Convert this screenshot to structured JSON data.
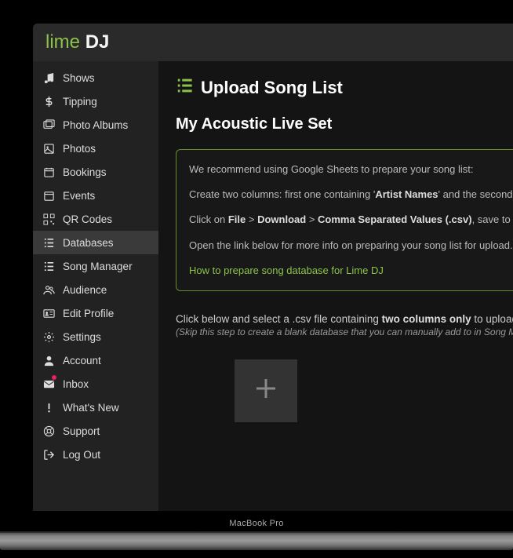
{
  "brand": {
    "part1": "lime",
    "part2": "DJ"
  },
  "sidebar": {
    "items": [
      {
        "label": "Shows"
      },
      {
        "label": "Tipping"
      },
      {
        "label": "Photo Albums"
      },
      {
        "label": "Photos"
      },
      {
        "label": "Bookings"
      },
      {
        "label": "Events"
      },
      {
        "label": "QR Codes"
      },
      {
        "label": "Databases"
      },
      {
        "label": "Song Manager"
      },
      {
        "label": "Audience"
      },
      {
        "label": "Edit Profile"
      },
      {
        "label": "Settings"
      },
      {
        "label": "Account"
      },
      {
        "label": "Inbox"
      },
      {
        "label": "What's New"
      },
      {
        "label": "Support"
      },
      {
        "label": "Log Out"
      }
    ],
    "active_index": 7
  },
  "page": {
    "title": "Upload Song List",
    "subtitle": "My Acoustic Live Set"
  },
  "info": {
    "line1": "We recommend using Google Sheets to prepare your song list:",
    "line2_pre": "Create two columns: first one containing '",
    "line2_b1": "Artist Names",
    "line2_mid": "' and the second o",
    "line3_pre": "Click on ",
    "line3_b1": "File",
    "line3_sep1": " > ",
    "line3_b2": "Download",
    "line3_sep2": " > ",
    "line3_b3": "Comma Separated Values (.csv)",
    "line3_post": ", save to your",
    "line4": "Open the link below for more info on preparing your song list for upload..",
    "link": "How to prepare song database for Lime DJ"
  },
  "instruction": {
    "pre": "Click below and select a .csv file containing ",
    "bold": "two columns only",
    "post": " to upload.",
    "sub": "(Skip this step to create a blank database that you can manually add to in Song Manager)"
  },
  "device_label": "MacBook Pro"
}
